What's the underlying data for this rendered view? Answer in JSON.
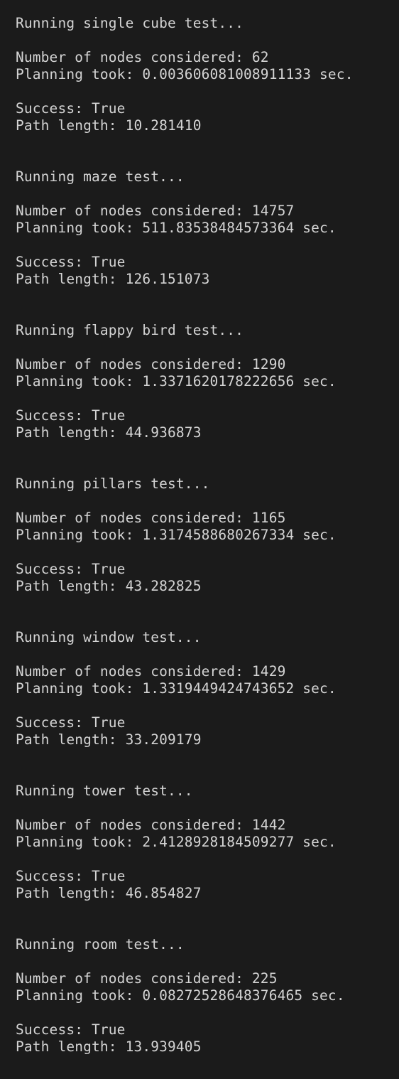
{
  "terminal": {
    "tests": [
      {
        "header": "Running single cube test...",
        "nodes": "Number of nodes considered: 62",
        "planning": "Planning took: 0.003606081008911133 sec.",
        "success": "Success: True",
        "path": "Path length: 10.281410"
      },
      {
        "header": "Running maze test...",
        "nodes": "Number of nodes considered: 14757",
        "planning": "Planning took: 511.83538484573364 sec.",
        "success": "Success: True",
        "path": "Path length: 126.151073"
      },
      {
        "header": "Running flappy bird test...",
        "nodes": "Number of nodes considered: 1290",
        "planning": "Planning took: 1.3371620178222656 sec.",
        "success": "Success: True",
        "path": "Path length: 44.936873"
      },
      {
        "header": "Running pillars test...",
        "nodes": "Number of nodes considered: 1165",
        "planning": "Planning took: 1.3174588680267334 sec.",
        "success": "Success: True",
        "path": "Path length: 43.282825"
      },
      {
        "header": "Running window test...",
        "nodes": "Number of nodes considered: 1429",
        "planning": "Planning took: 1.3319449424743652 sec.",
        "success": "Success: True",
        "path": "Path length: 33.209179"
      },
      {
        "header": "Running tower test...",
        "nodes": "Number of nodes considered: 1442",
        "planning": "Planning took: 2.4128928184509277 sec.",
        "success": "Success: True",
        "path": "Path length: 46.854827"
      },
      {
        "header": "Running room test...",
        "nodes": "Number of nodes considered: 225",
        "planning": "Planning took: 0.08272528648376465 sec.",
        "success": "Success: True",
        "path": "Path length: 13.939405"
      }
    ]
  }
}
